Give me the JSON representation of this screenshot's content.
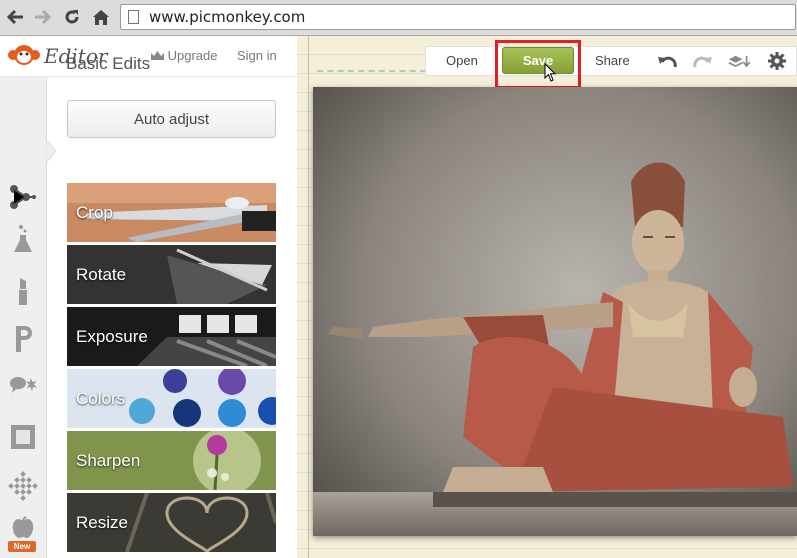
{
  "browser": {
    "url": "www.picmonkey.com"
  },
  "header": {
    "logo_text": "Editor",
    "upgrade_label": "Upgrade",
    "signin_label": "Sign in"
  },
  "tools": [
    {
      "name": "basic-edits-icon"
    },
    {
      "name": "effects-flask-icon"
    },
    {
      "name": "touch-up-lipstick-icon"
    },
    {
      "name": "text-p-icon"
    },
    {
      "name": "overlays-icon"
    },
    {
      "name": "frames-icon"
    },
    {
      "name": "textures-icon"
    },
    {
      "name": "seasonal-apple-icon"
    }
  ],
  "badge": {
    "new_label": "New"
  },
  "panel": {
    "title": "Basic Edits",
    "auto_adjust_label": "Auto adjust",
    "tiles": [
      "Crop",
      "Rotate",
      "Exposure",
      "Colors",
      "Sharpen",
      "Resize"
    ]
  },
  "toolbar": {
    "open_label": "Open",
    "save_label": "Save",
    "share_label": "Share"
  },
  "colors": {
    "save_green": "#9ab646",
    "highlight_red": "#e21f26"
  }
}
